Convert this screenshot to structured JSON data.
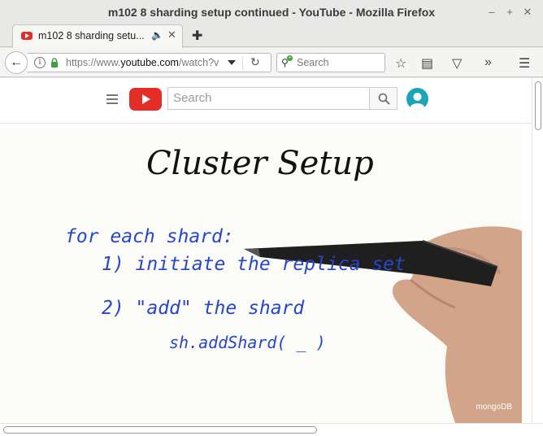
{
  "window": {
    "title": "m102 8 sharding setup continued - YouTube - Mozilla Firefox"
  },
  "tab": {
    "title": "m102 8 sharding setu...",
    "favicon": "youtube-favicon-icon"
  },
  "navbar": {
    "url_prefix": "https://www.",
    "url_domain": "youtube.com",
    "url_path": "/watch?v",
    "search_placeholder": "Search"
  },
  "youtube": {
    "search_placeholder": "Search",
    "accent": "#e52d27",
    "avatar_color": "#1ba6b7"
  },
  "video": {
    "heading": "Cluster Setup",
    "line1": "for each shard:",
    "line2": "1) initiate the replica set",
    "line3": "2) \"add\" the shard",
    "line4": "sh.addShard( _ )",
    "watermark": "mongoDB",
    "ink_blue": "#2846c8",
    "ink_black": "#111111"
  }
}
